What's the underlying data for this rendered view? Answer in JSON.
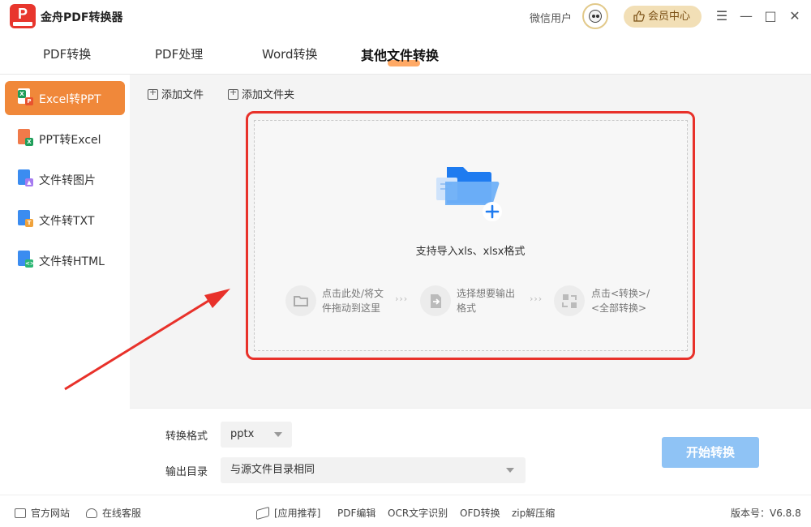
{
  "app": {
    "title": "金舟PDF转换器",
    "logo_letter": "P"
  },
  "user": {
    "name": "微信用户",
    "vip_label": "会员中心"
  },
  "window_controls": {
    "menu": "☰",
    "minimize": "—",
    "maximize": "□",
    "close": "✕"
  },
  "tabs": [
    {
      "label": "PDF转换"
    },
    {
      "label": "PDF处理"
    },
    {
      "label": "Word转换"
    },
    {
      "label": "其他文件转换",
      "active": true
    }
  ],
  "sidebar": {
    "items": [
      {
        "label": "Excel转PPT",
        "active": true
      },
      {
        "label": "PPT转Excel"
      },
      {
        "label": "文件转图片"
      },
      {
        "label": "文件转TXT"
      },
      {
        "label": "文件转HTML"
      }
    ]
  },
  "toolbar": {
    "add_file": "添加文件",
    "add_folder": "添加文件夹"
  },
  "dropzone": {
    "title": "支持导入xls、xlsx格式",
    "steps": [
      {
        "line1": "点击此处/将文",
        "line2": "件拖动到这里"
      },
      {
        "line1": "选择想要输出",
        "line2": "格式"
      },
      {
        "line1": "点击<转换>/",
        "line2": "<全部转换>"
      }
    ],
    "separator": "›››"
  },
  "settings": {
    "format_label": "转换格式",
    "format_value": "pptx",
    "output_label": "输出目录",
    "output_value": "与源文件目录相同",
    "start_label": "开始转换"
  },
  "statusbar": {
    "official_site": "官方网站",
    "online_service": "在线客服",
    "recommend": "[应用推荐]",
    "links": [
      "PDF编辑",
      "OCR文字识别",
      "OFD转换",
      "zip解压缩"
    ],
    "version": "版本号：V6.8.8"
  },
  "colors": {
    "accent": "#f0883a",
    "highlight_red": "#e8312a",
    "start_button": "#8fc3f5",
    "folder_blue": "#1e7bf0"
  }
}
